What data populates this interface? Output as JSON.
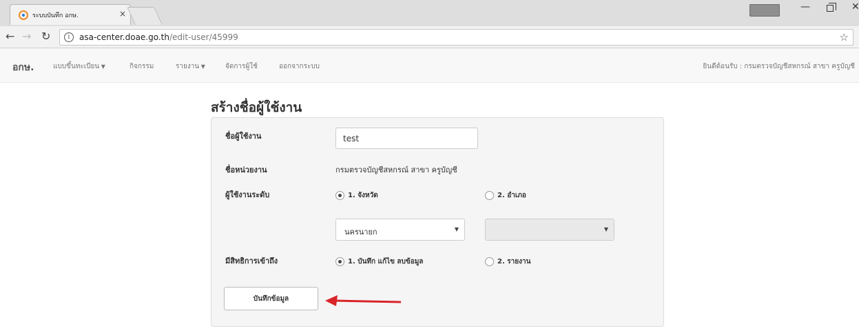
{
  "browser": {
    "tab_title": "ระบบบันทึก อกษ.",
    "tab_close": "×",
    "url_host": "asa-center.doae.go.th",
    "url_path": "/edit-user/45999",
    "info_icon": "i",
    "icons": [
      "back-arrow-icon",
      "forward-arrow-icon",
      "reload-icon",
      "info-icon",
      "star-icon",
      "minimize-icon",
      "maximize-icon",
      "close-icon"
    ]
  },
  "navbar": {
    "brand": "อกษ.",
    "items": [
      {
        "label": "แบบขึ้นทะเบียน",
        "dropdown": true
      },
      {
        "label": "กิจกรรม",
        "dropdown": false
      },
      {
        "label": "รายงาน",
        "dropdown": true
      },
      {
        "label": "จัดการผู้ใช้",
        "dropdown": false
      },
      {
        "label": "ออกจากระบบ",
        "dropdown": false
      }
    ],
    "welcome": "ยินดีต้อนรับ : กรมตรวจบัญชีสหกรณ์ สาขา ครูบัญชี"
  },
  "form": {
    "title": "สร้างชื่อผู้ใช้งาน",
    "username_label": "ชื่อผู้ใช้งาน",
    "username_value": "test",
    "unit_label": "ชื่อหน่วยงาน",
    "unit_value": "กรมตรวจบัญชีสหกรณ์ สาขา ครูบัญชี",
    "level_label": "ผู้ใช้งานระดับ",
    "level_option_1": "1. จังหวัด",
    "level_option_2": "2. อำเภอ",
    "level_selected": 1,
    "province_value": "นครนายก",
    "district_value": "",
    "access_label": "มีสิทธิการเข้าถึง",
    "access_option_1": "1. บันทึก แก้ไข ลบข้อมูล",
    "access_option_2": "2. รายงาน",
    "access_selected": 1,
    "save_label": "บันทึกข้อมูล"
  },
  "colors": {
    "annotation_arrow": "#d9242a",
    "navbar_bg": "#f8f8f8",
    "panel_bg": "#f5f5f5"
  }
}
